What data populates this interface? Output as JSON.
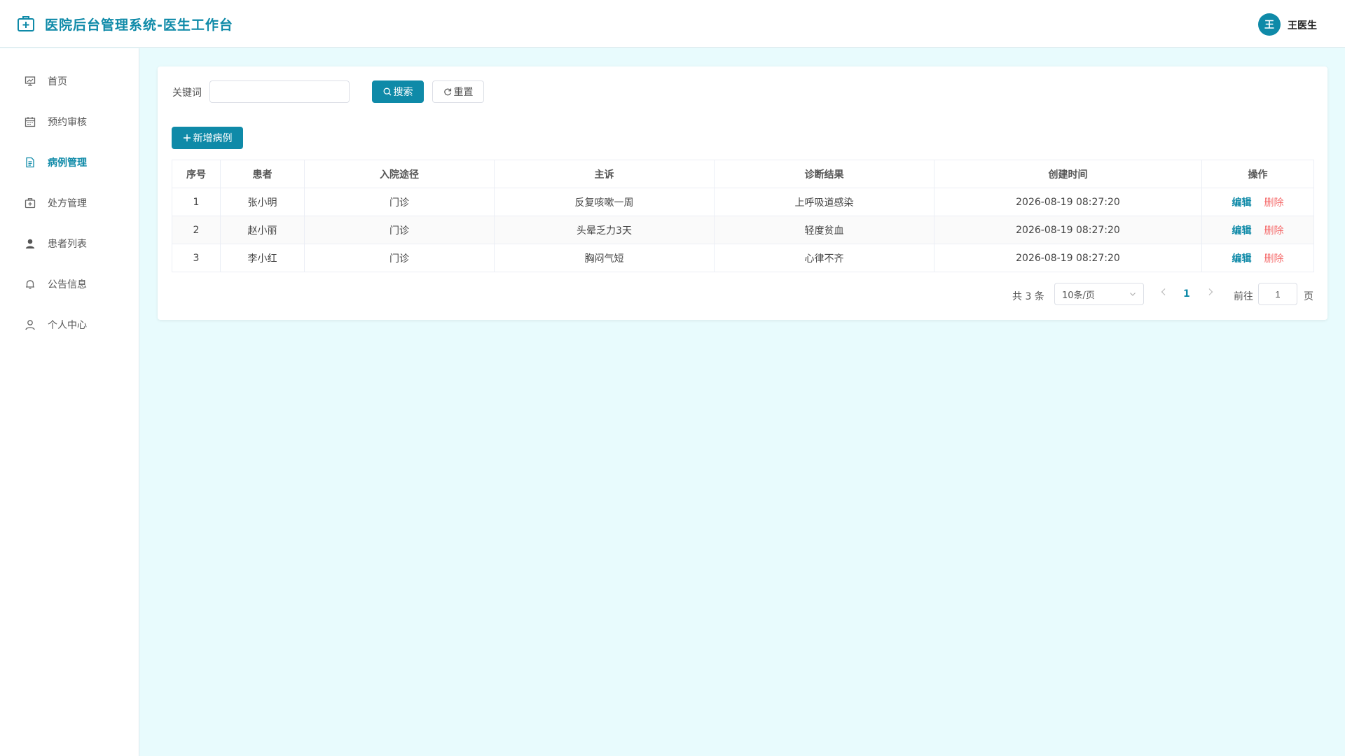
{
  "header": {
    "title": "医院后台管理系统-医生工作台",
    "user_initial": "王",
    "user_name": "王医生",
    "logo_icon": "medical-kit-icon"
  },
  "sidebar": {
    "items": [
      {
        "label": "首页",
        "icon": "presentation-icon",
        "active": false
      },
      {
        "label": "预约审核",
        "icon": "calendar-icon",
        "active": false
      },
      {
        "label": "病例管理",
        "icon": "document-icon",
        "active": true
      },
      {
        "label": "处方管理",
        "icon": "medical-box-icon",
        "active": false
      },
      {
        "label": "患者列表",
        "icon": "user-filled-icon",
        "active": false
      },
      {
        "label": "公告信息",
        "icon": "bell-icon",
        "active": false
      },
      {
        "label": "个人中心",
        "icon": "user-outline-icon",
        "active": false
      }
    ]
  },
  "search": {
    "keyword_label": "关键词",
    "keyword_value": "",
    "search_button": "搜索",
    "reset_button": "重置"
  },
  "toolbar": {
    "add_button": "新增病例"
  },
  "table": {
    "headers": [
      "序号",
      "患者",
      "入院途径",
      "主诉",
      "诊断结果",
      "创建时间",
      "操作"
    ],
    "rows": [
      {
        "index": "1",
        "patient": "张小明",
        "route": "门诊",
        "complaint": "反复咳嗽一周",
        "diagnosis": "上呼吸道感染",
        "created": "2026-08-19 08:27:20"
      },
      {
        "index": "2",
        "patient": "赵小丽",
        "route": "门诊",
        "complaint": "头晕乏力3天",
        "diagnosis": "轻度贫血",
        "created": "2026-08-19 08:27:20"
      },
      {
        "index": "3",
        "patient": "李小红",
        "route": "门诊",
        "complaint": "胸闷气短",
        "diagnosis": "心律不齐",
        "created": "2026-08-19 08:27:20"
      }
    ],
    "edit_label": "编辑",
    "delete_label": "删除"
  },
  "pagination": {
    "total": "共 3 条",
    "page_size": "10条/页",
    "current_page": "1",
    "goto_label": "前往",
    "goto_value": "1",
    "goto_suffix": "页"
  },
  "colors": {
    "primary": "#0f8aa8",
    "danger": "#f56c6c",
    "background": "#e8fbfd"
  }
}
